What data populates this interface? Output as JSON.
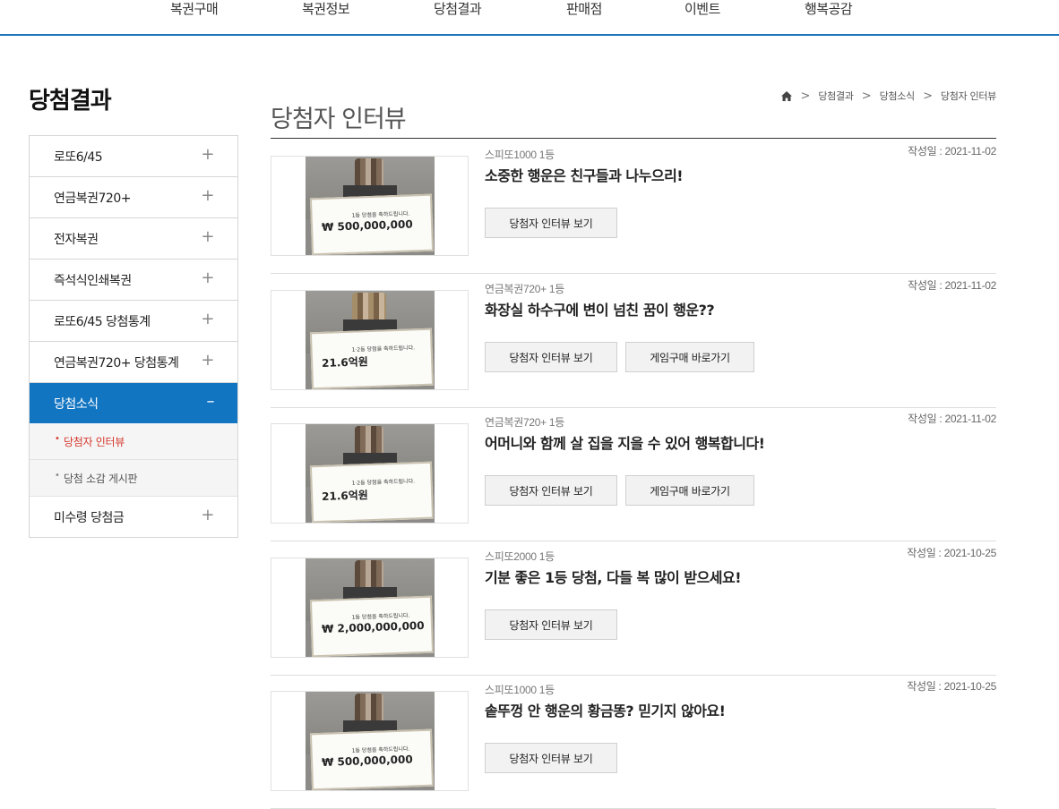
{
  "nav": {
    "items": [
      "복권구매",
      "복권정보",
      "당첨결과",
      "판매점",
      "이벤트",
      "행복공감"
    ],
    "accent_color": "#1c74bd"
  },
  "sidebar": {
    "title": "당첨결과",
    "items": [
      {
        "label": "로또6/45",
        "state": "+"
      },
      {
        "label": "연금복권720+",
        "state": "+"
      },
      {
        "label": "전자복권",
        "state": "+"
      },
      {
        "label": "즉석식인쇄복권",
        "state": "+"
      },
      {
        "label": "로또6/45 당첨통계",
        "state": "+"
      },
      {
        "label": "연금복권720+ 당첨통계",
        "state": "+"
      },
      {
        "label": "당첨소식",
        "state": "–"
      },
      {
        "label": "미수령 당첨금",
        "state": "+"
      }
    ],
    "sub_items": [
      {
        "label": "당첨자 인터뷰"
      },
      {
        "label": "당첨 소감 게시판"
      }
    ],
    "bullet": "•",
    "active_color": "#1275c2"
  },
  "page": {
    "title": "당첨자 인터뷰",
    "breadcrumb": [
      "당첨결과",
      "당첨소식",
      "당첨자 인터뷰"
    ],
    "separator": ">"
  },
  "cards": [
    {
      "category": "스피또1000 1등",
      "headline": "소중한 행운은 친구들과 나누으리!",
      "date": "작성일 : 2021-11-02",
      "interview_label": "당첨자 인터뷰 보기",
      "buy_label": "",
      "board_title": "1등 당첨을 축하드립니다.",
      "board_amount": "₩ 500,000,000",
      "hair": "dark"
    },
    {
      "category": "연금복권720+ 1등",
      "headline": "화장실 하수구에 변이 넘친 꿈이 행운??",
      "date": "작성일 : 2021-11-02",
      "interview_label": "당첨자 인터뷰 보기",
      "buy_label": "게임구매 바로가기",
      "board_title": "1·2등 당첨을 축하드립니다.",
      "board_amount": "21.6억원",
      "hair": "blonde"
    },
    {
      "category": "연금복권720+ 1등",
      "headline": "어머니와 함께 살 집을 지을 수 있어 행복합니다!",
      "date": "작성일 : 2021-11-02",
      "interview_label": "당첨자 인터뷰 보기",
      "buy_label": "게임구매 바로가기",
      "board_title": "1·2등 당첨을 축하드립니다.",
      "board_amount": "21.6억원",
      "hair": "dark"
    },
    {
      "category": "스피또2000 1등",
      "headline": "기분 좋은 1등 당첨, 다들 복 많이 받으세요!",
      "date": "작성일 : 2021-10-25",
      "interview_label": "당첨자 인터뷰 보기",
      "buy_label": "",
      "board_title": "1등 당첨을 축하드립니다.",
      "board_amount": "₩ 2,000,000,000",
      "hair": "dark"
    },
    {
      "category": "스피또1000 1등",
      "headline": "솥뚜껑 안 행운의 황금똥? 믿기지 않아요!",
      "date": "작성일 : 2021-10-25",
      "interview_label": "당첨자 인터뷰 보기",
      "buy_label": "",
      "board_title": "1등 당첨을 축하드립니다.",
      "board_amount": "₩ 500,000,000",
      "hair": "dark"
    }
  ]
}
